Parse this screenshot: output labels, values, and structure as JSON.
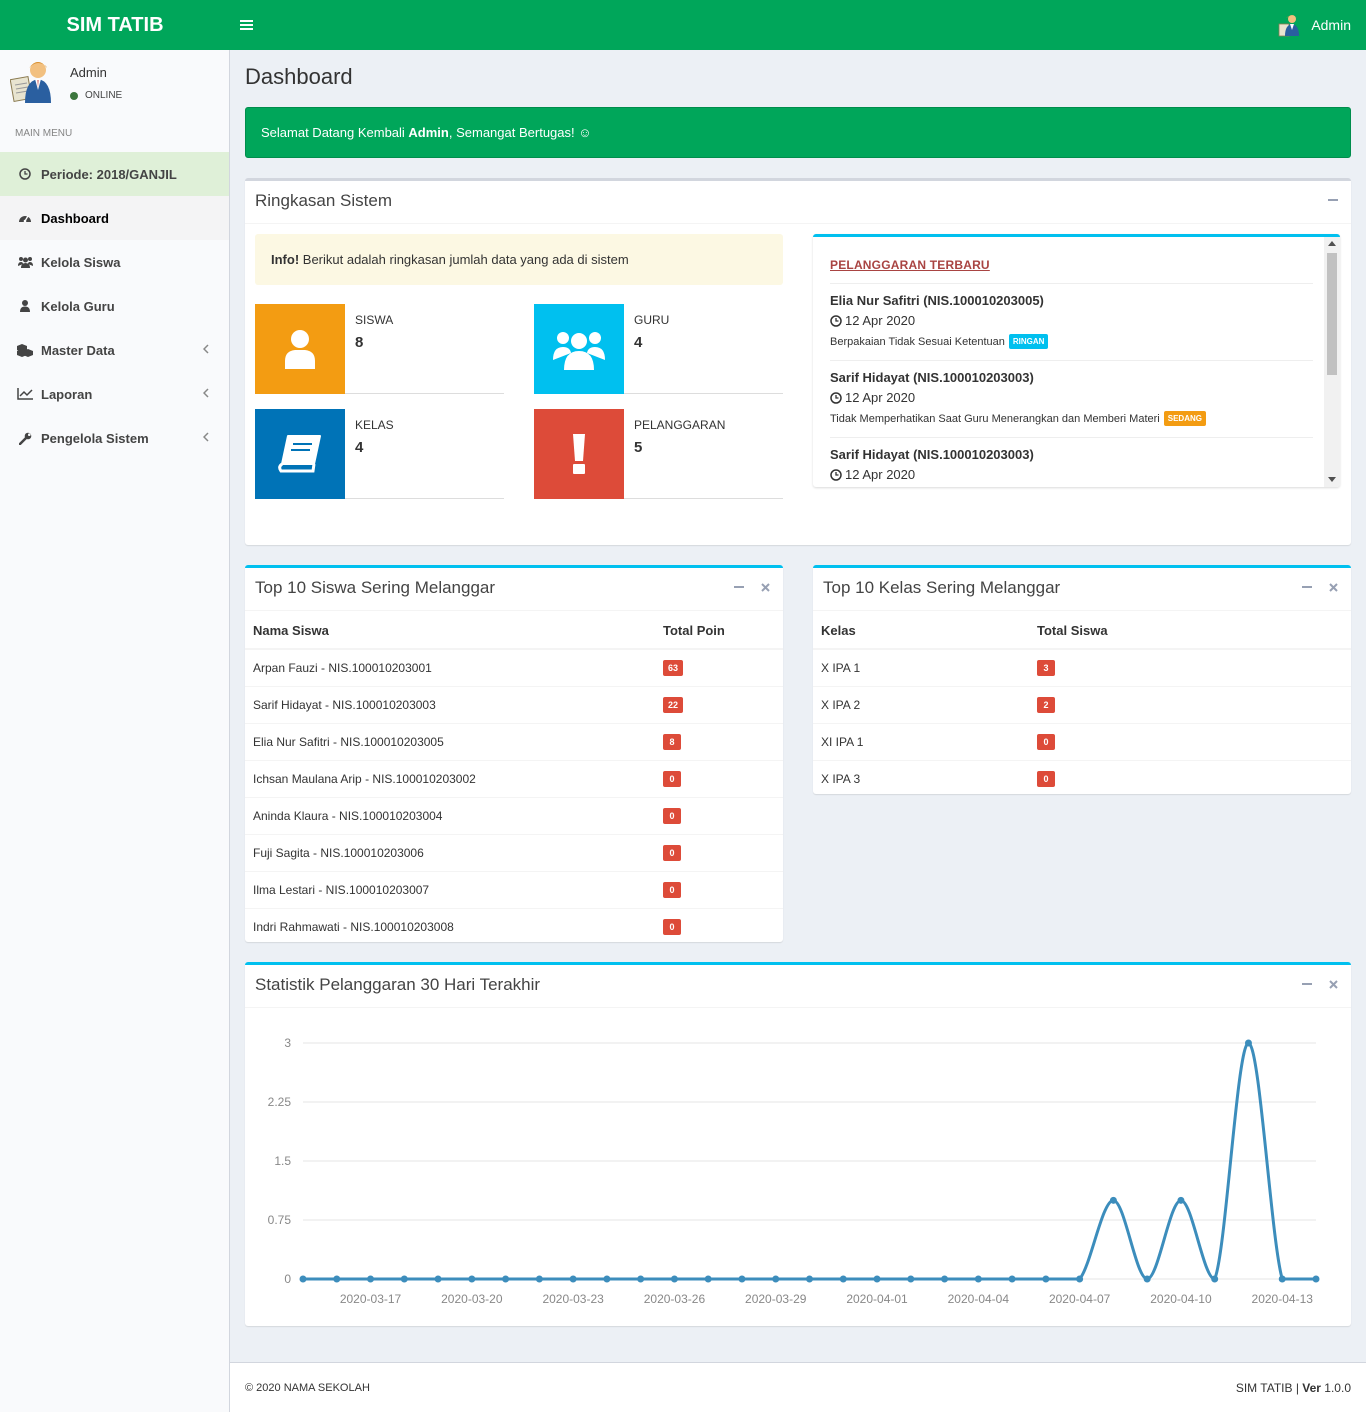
{
  "header": {
    "app_name": "SIM TATIB",
    "menu_icon": "bars-icon",
    "user_name": "Admin"
  },
  "sidebar": {
    "user_name": "Admin",
    "status": "ONLINE",
    "menu_header": "MAIN MENU",
    "items": [
      {
        "label": "Periode: 2018/GANJIL",
        "icon": "clock-icon"
      },
      {
        "label": "Dashboard",
        "icon": "dashboard-icon"
      },
      {
        "label": "Kelola Siswa",
        "icon": "users-icon"
      },
      {
        "label": "Kelola Guru",
        "icon": "user-icon"
      },
      {
        "label": "Master Data",
        "icon": "cubes-icon"
      },
      {
        "label": "Laporan",
        "icon": "line-chart-icon"
      },
      {
        "label": "Pengelola Sistem",
        "icon": "wrench-icon"
      }
    ]
  },
  "page": {
    "title": "Dashboard",
    "welcome_prefix": "Selamat Datang Kembali ",
    "welcome_user": "Admin",
    "welcome_suffix": ", Semangat Bertugas! ☺"
  },
  "summary": {
    "title": "Ringkasan Sistem",
    "info_label": "Info!",
    "info_text": " Berikut adalah ringkasan jumlah data yang ada di sistem",
    "stats": [
      {
        "label": "SISWA",
        "value": "8",
        "color": "#f39c12",
        "icon": "user-icon"
      },
      {
        "label": "GURU",
        "value": "4",
        "color": "#00c0ef",
        "icon": "users-icon"
      },
      {
        "label": "KELAS",
        "value": "4",
        "color": "#0073b7",
        "icon": "book-icon"
      },
      {
        "label": "PELANGGARAN",
        "value": "5",
        "color": "#dd4b39",
        "icon": "exclamation-icon"
      }
    ],
    "recent_title": "PELANGGARAN TERBARU",
    "recent": [
      {
        "name": "Elia Nur Safitri (NIS.100010203005)",
        "date": "12 Apr 2020",
        "desc": "Berpakaian Tidak Sesuai Ketentuan",
        "level": "RINGAN",
        "level_color": "#00c0ef"
      },
      {
        "name": "Sarif Hidayat (NIS.100010203003)",
        "date": "12 Apr 2020",
        "desc": "Tidak Memperhatikan Saat Guru Menerangkan dan Memberi Materi",
        "level": "SEDANG",
        "level_color": "#f39c12"
      },
      {
        "name": "Sarif Hidayat (NIS.100010203003)",
        "date": "12 Apr 2020"
      }
    ]
  },
  "top_siswa": {
    "title": "Top 10 Siswa Sering Melanggar",
    "col_name": "Nama Siswa",
    "col_value": "Total Poin",
    "rows": [
      {
        "name": "Arpan Fauzi - NIS.100010203001",
        "value": "63"
      },
      {
        "name": "Sarif Hidayat - NIS.100010203003",
        "value": "22"
      },
      {
        "name": "Elia Nur Safitri - NIS.100010203005",
        "value": "8"
      },
      {
        "name": "Ichsan Maulana Arip - NIS.100010203002",
        "value": "0"
      },
      {
        "name": "Aninda Klaura - NIS.100010203004",
        "value": "0"
      },
      {
        "name": "Fuji Sagita - NIS.100010203006",
        "value": "0"
      },
      {
        "name": "Ilma Lestari - NIS.100010203007",
        "value": "0"
      },
      {
        "name": "Indri Rahmawati - NIS.100010203008",
        "value": "0"
      }
    ]
  },
  "top_kelas": {
    "title": "Top 10 Kelas Sering Melanggar",
    "col_name": "Kelas",
    "col_value": "Total Siswa",
    "rows": [
      {
        "name": "X IPA 1",
        "value": "3"
      },
      {
        "name": "X IPA 2",
        "value": "2"
      },
      {
        "name": "XI IPA 1",
        "value": "0"
      },
      {
        "name": "X IPA 3",
        "value": "0"
      }
    ]
  },
  "stats_box": {
    "title": "Statistik Pelanggaran 30 Hari Terakhir"
  },
  "chart_data": {
    "type": "line",
    "title": "",
    "xlabel": "",
    "ylabel": "",
    "ylim": [
      0,
      3
    ],
    "y_ticks": [
      "0",
      "0.75",
      "1.5",
      "2.25",
      "3"
    ],
    "x_tick_labels": [
      "2020-03-17",
      "2020-03-20",
      "2020-03-23",
      "2020-03-26",
      "2020-03-29",
      "2020-04-01",
      "2020-04-04",
      "2020-04-07",
      "2020-04-10",
      "2020-04-13"
    ],
    "line_color": "#3c8dbc",
    "grid": true,
    "x": [
      "2020-03-15",
      "2020-03-16",
      "2020-03-17",
      "2020-03-18",
      "2020-03-19",
      "2020-03-20",
      "2020-03-21",
      "2020-03-22",
      "2020-03-23",
      "2020-03-24",
      "2020-03-25",
      "2020-03-26",
      "2020-03-27",
      "2020-03-28",
      "2020-03-29",
      "2020-03-30",
      "2020-03-31",
      "2020-04-01",
      "2020-04-02",
      "2020-04-03",
      "2020-04-04",
      "2020-04-05",
      "2020-04-06",
      "2020-04-07",
      "2020-04-08",
      "2020-04-09",
      "2020-04-10",
      "2020-04-11",
      "2020-04-12",
      "2020-04-13",
      "2020-04-14"
    ],
    "values": [
      0,
      0,
      0,
      0,
      0,
      0,
      0,
      0,
      0,
      0,
      0,
      0,
      0,
      0,
      0,
      0,
      0,
      0,
      0,
      0,
      0,
      0,
      0,
      0,
      1,
      0,
      1,
      0,
      3,
      0,
      0
    ]
  },
  "footer": {
    "copyright": "© 2020   NAMA SEKOLAH",
    "app": "SIM TATIB",
    "ver_label": "Ver",
    "ver": " 1.0.0"
  }
}
